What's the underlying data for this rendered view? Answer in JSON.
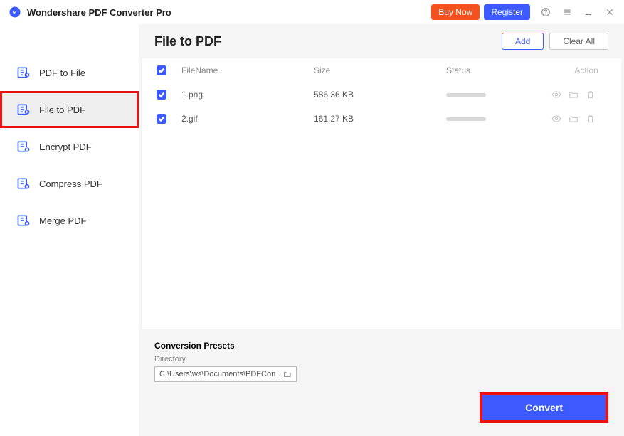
{
  "app_title": "Wondershare PDF Converter Pro",
  "titlebar": {
    "buy": "Buy Now",
    "register": "Register"
  },
  "sidebar": {
    "items": [
      {
        "label": "PDF to File",
        "active": false
      },
      {
        "label": "File to PDF",
        "active": true
      },
      {
        "label": "Encrypt PDF",
        "active": false
      },
      {
        "label": "Compress PDF",
        "active": false
      },
      {
        "label": "Merge PDF",
        "active": false
      }
    ]
  },
  "page": {
    "title": "File to PDF",
    "add": "Add",
    "clear": "Clear All"
  },
  "table": {
    "headers": {
      "filename": "FileName",
      "size": "Size",
      "status": "Status",
      "action": "Action"
    },
    "rows": [
      {
        "checked": true,
        "filename": "1.png",
        "size": "586.36 KB"
      },
      {
        "checked": true,
        "filename": "2.gif",
        "size": "161.27 KB"
      }
    ]
  },
  "presets": {
    "title": "Conversion Presets",
    "dir_label": "Directory",
    "dir_value": "C:\\Users\\ws\\Documents\\PDFConvert"
  },
  "convert": "Convert"
}
